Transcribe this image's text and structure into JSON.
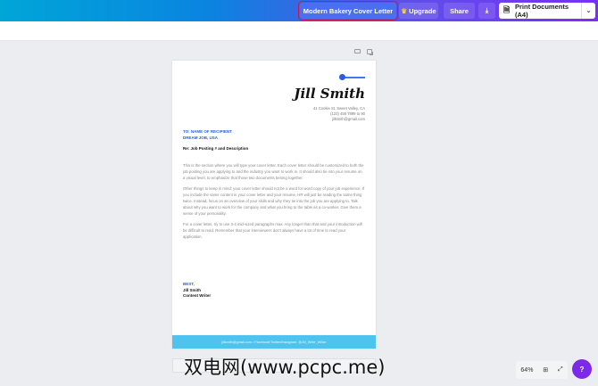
{
  "header": {
    "doc_title": "Modern Bakery Cover Letter",
    "upgrade": "Upgrade",
    "share": "Share",
    "print": "Print Documents (A4)"
  },
  "letter": {
    "name": "Jill Smith",
    "address": [
      "41 Cookie St, Sweet Valley, CA",
      "(123) 456 7899 to 90",
      "jillsmith@gmail.com"
    ],
    "to": [
      "TO: NAME OF RECIPIENT",
      "DREAM JOB, USA"
    ],
    "re": "Re: Job Posting # and Description",
    "paragraphs": [
      "This is the section where you will type your cover letter. Each cover letter should be customized to both the job posting you are applying to and the industry you want to work in. It should also tie into your resume on a visual level, to emphasize that those two documents belong together.",
      "Other things to keep in mind: your cover letter should not be a word for word copy of your job experience. If you include the same content in your cover letter and your resume, HR will just be reading the same thing twice. Instead, focus on an overview of your skills and why they tie into the job you are applying to. Talk about why you want to work for the company and what you bring to the table as a co-worker. Give them a sense of your personality.",
      "For a cover letter, try to use 3-4 mid-sized paragraphs max. Any longer than that and your introduction will be difficult to read. Remember that your interviewers don't always have a lot of time to read your application."
    ],
    "closing": "BEST,",
    "signer": "Jill Smith",
    "signer_title": "Content Writer",
    "footer": "jillsmith@gmail.com • Facebook/Twitter/Instagram: @Jill_Write_Writer"
  },
  "zoom": {
    "level": "64%"
  },
  "help": "?",
  "watermark": "双电网(www.pcpc.me)",
  "colors": {
    "accent": "#7d2ae8",
    "letter_blue": "#2c5cd8",
    "footer": "#4fc3ef"
  }
}
